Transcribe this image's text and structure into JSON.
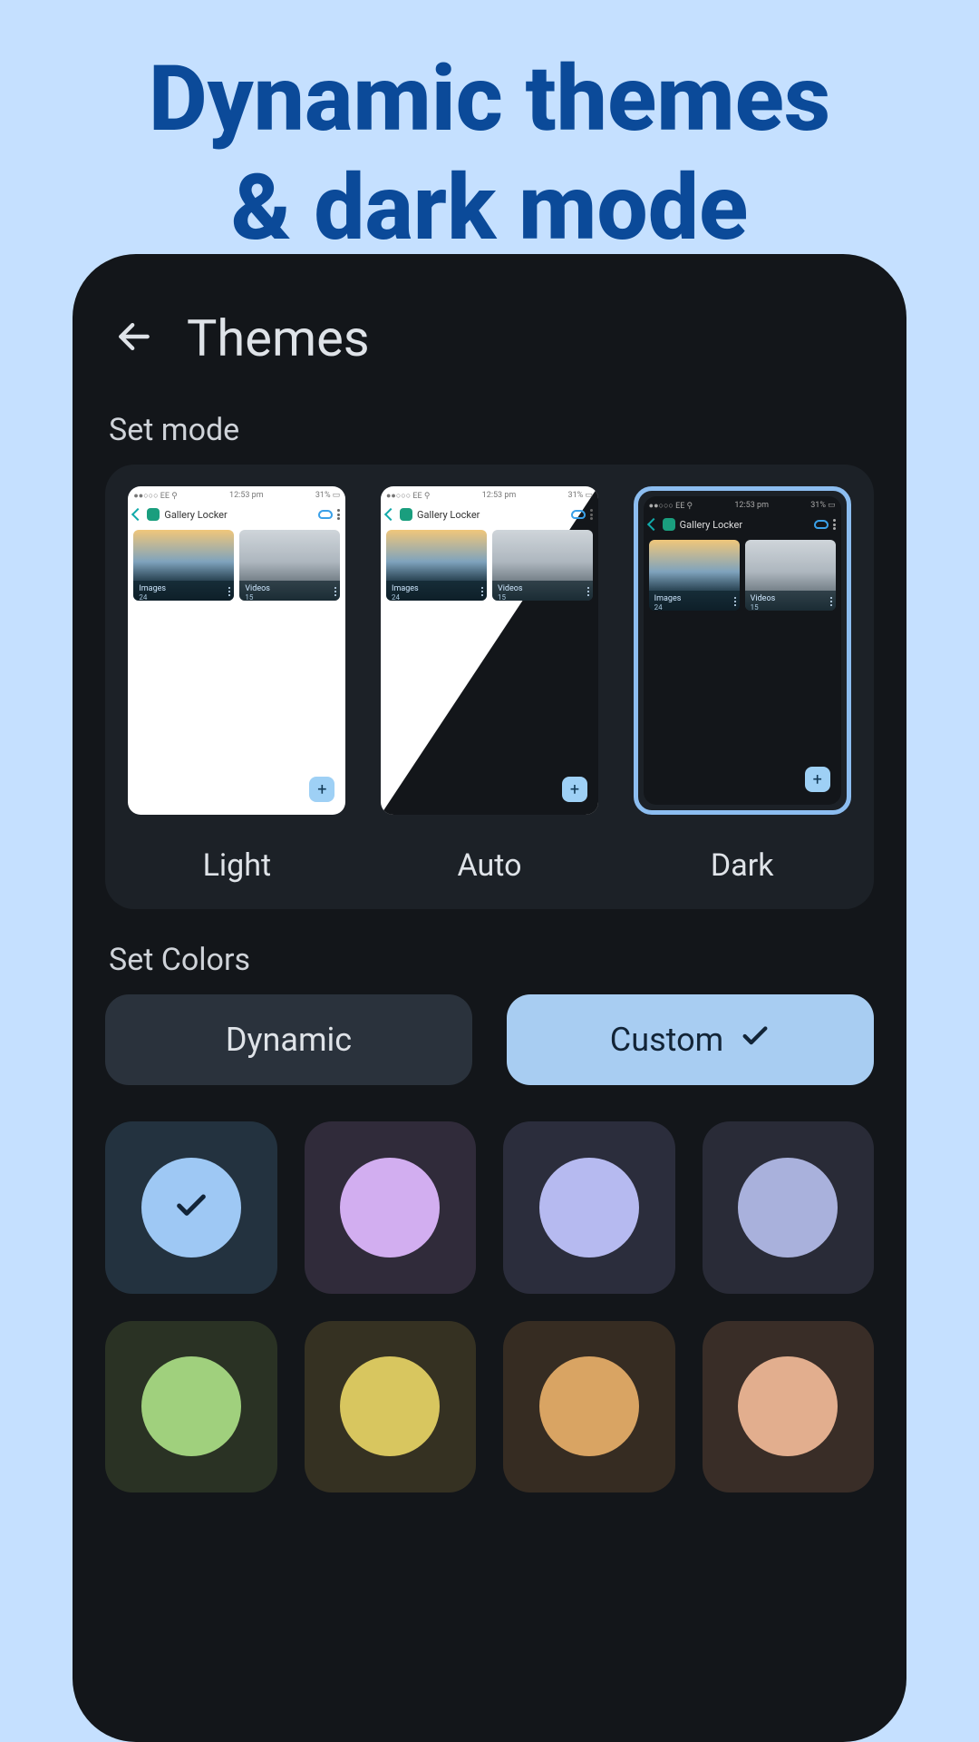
{
  "promo": {
    "line1": "Dynamic themes",
    "line2": "& dark mode"
  },
  "screen": {
    "title": "Themes"
  },
  "mode": {
    "section_label": "Set mode",
    "options": [
      {
        "label": "Light",
        "selected": false
      },
      {
        "label": "Auto",
        "selected": false
      },
      {
        "label": "Dark",
        "selected": true
      }
    ],
    "preview": {
      "status_left": "●●○○○ EE ⚲",
      "status_time": "12:53 pm",
      "status_right": "31% ▭",
      "app_title": "Gallery Locker",
      "tiles": [
        {
          "caption": "Images",
          "count": "24"
        },
        {
          "caption": "Videos",
          "count": "15"
        }
      ],
      "fab": "+"
    }
  },
  "colors": {
    "section_label": "Set Colors",
    "segments": [
      {
        "label": "Dynamic",
        "selected": false
      },
      {
        "label": "Custom",
        "selected": true
      }
    ],
    "swatches": [
      {
        "dot": "#9ec8f4",
        "bg": "#23323f",
        "selected": true
      },
      {
        "dot": "#d2aef0",
        "bg": "#302b3a",
        "selected": false
      },
      {
        "dot": "#b6baf0",
        "bg": "#2b2d3c",
        "selected": false
      },
      {
        "dot": "#a9b1dc",
        "bg": "#292b37",
        "selected": false
      },
      {
        "dot": "#a0d07d",
        "bg": "#2a3224",
        "selected": false
      },
      {
        "dot": "#d8c65f",
        "bg": "#353122",
        "selected": false
      },
      {
        "dot": "#d9a463",
        "bg": "#362c22",
        "selected": false
      },
      {
        "dot": "#e2ae8e",
        "bg": "#392d27",
        "selected": false
      }
    ]
  }
}
